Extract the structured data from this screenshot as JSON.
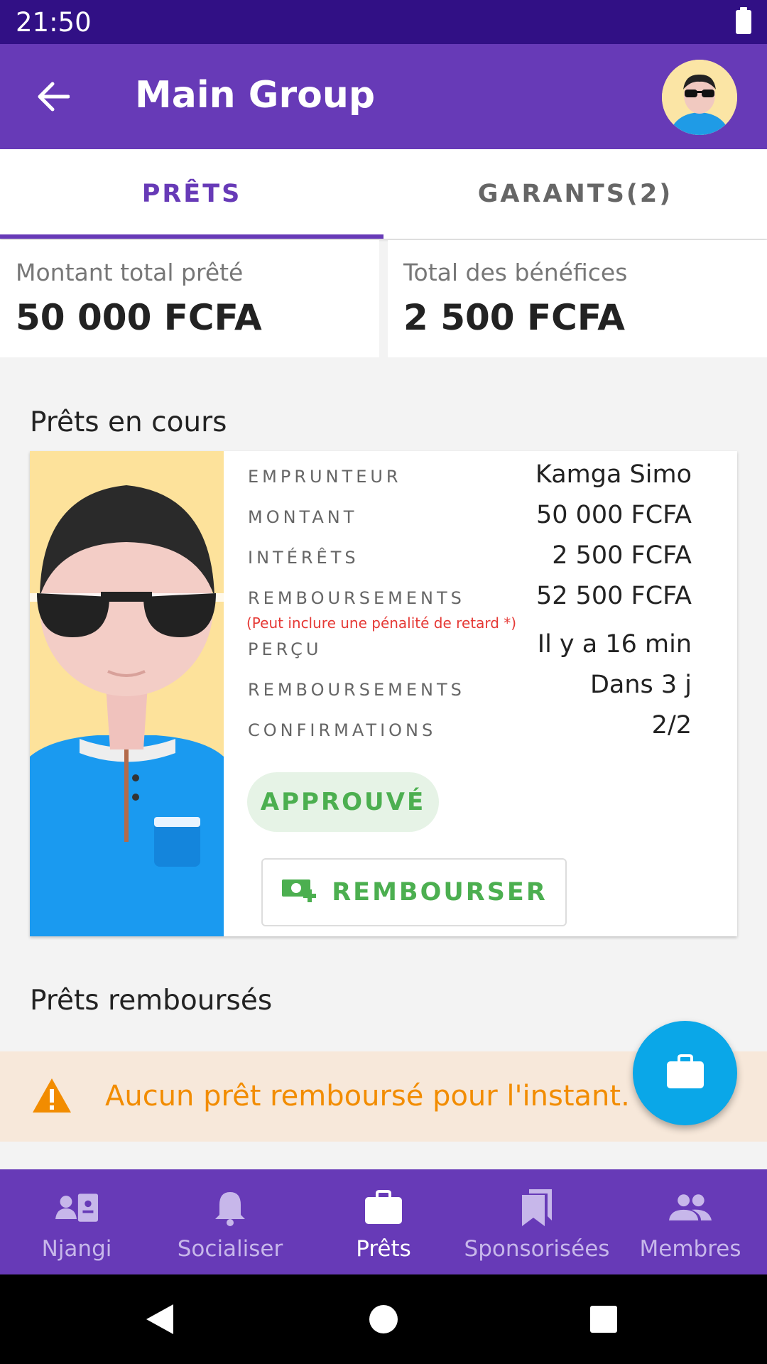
{
  "status_bar": {
    "time": "21:50"
  },
  "app_bar": {
    "title": "Main Group"
  },
  "tabs": [
    {
      "label": "PRÊTS",
      "active": true
    },
    {
      "label": "GARANTS(2)",
      "active": false
    }
  ],
  "summary": {
    "total_lent_label": "Montant total prêté",
    "total_lent_value": "50 000 FCFA",
    "total_benefits_label": "Total des bénéfices",
    "total_benefits_value": "2 500 FCFA"
  },
  "ongoing": {
    "section_title": "Prêts en cours",
    "loan": {
      "rows": [
        {
          "label": "EMPRUNTEUR",
          "value": "Kamga Simo"
        },
        {
          "label": "MONTANT",
          "value": "50 000 FCFA"
        },
        {
          "label": "INTÉRÊTS",
          "value": "2 500 FCFA"
        },
        {
          "label": "REMBOURSEMENTS",
          "value": "52 500 FCFA"
        },
        {
          "label": "PERÇU",
          "value": "Il y a 16 min"
        },
        {
          "label": "REMBOURSEMENTS",
          "value": "Dans 3 j"
        },
        {
          "label": "CONFIRMATIONS",
          "value": "2/2"
        }
      ],
      "penalty_note": "(Peut inclure une pénalité de retard *)",
      "status": "APPROUVÉ",
      "repay_button": "REMBOURSER"
    }
  },
  "repaid": {
    "section_title": "Prêts remboursés",
    "empty_message": "Aucun prêt remboursé pour l'instant."
  },
  "bottom_nav": [
    {
      "label": "Njangi",
      "icon": "id-card-icon",
      "active": false
    },
    {
      "label": "Socialiser",
      "icon": "bell-icon",
      "active": false
    },
    {
      "label": "Prêts",
      "icon": "briefcase-icon",
      "active": true
    },
    {
      "label": "Sponsorisées",
      "icon": "bookmarks-icon",
      "active": false
    },
    {
      "label": "Membres",
      "icon": "people-icon",
      "active": false
    }
  ],
  "colors": {
    "primary": "#673ab7",
    "status_bar": "#311085",
    "success": "#4caf50",
    "warning": "#f28c00",
    "fab": "#0aa7e8"
  }
}
